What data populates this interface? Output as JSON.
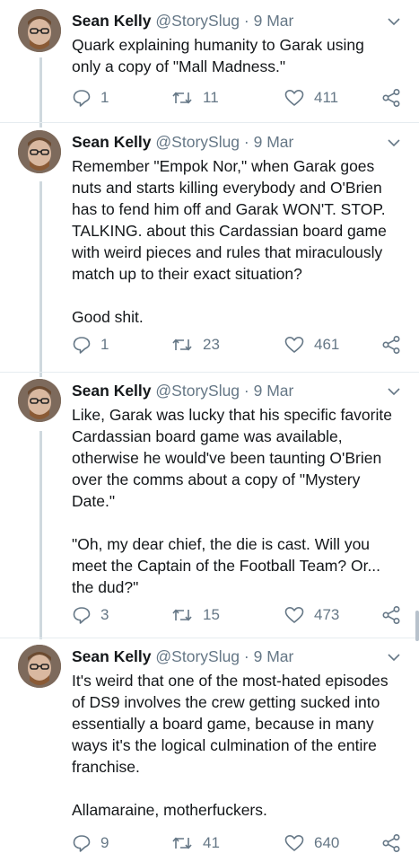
{
  "colors": {
    "text": "#14171a",
    "meta": "#657786",
    "thread_line": "#cfd9de",
    "divider": "#e6ecf0",
    "icon": "#657786"
  },
  "tweets": [
    {
      "author_name": "Sean Kelly",
      "handle": "@StorySlug",
      "dot": "·",
      "date": "9 Mar",
      "text": "Quark explaining humanity to Garak using only a copy of \"Mall Madness.\"",
      "replies": "1",
      "retweets": "11",
      "likes": "411"
    },
    {
      "author_name": "Sean Kelly",
      "handle": "@StorySlug",
      "dot": "·",
      "date": "9 Mar",
      "text": "Remember \"Empok Nor,\" when Garak goes nuts and starts killing everybody and O'Brien has to fend him off and Garak WON'T. STOP. TALKING. about this Cardassian board game with weird pieces and rules that miraculously match up to their exact situation?\n\nGood shit.",
      "replies": "1",
      "retweets": "23",
      "likes": "461"
    },
    {
      "author_name": "Sean Kelly",
      "handle": "@StorySlug",
      "dot": "·",
      "date": "9 Mar",
      "text": "Like, Garak was lucky that his specific favorite Cardassian board game was available, otherwise he would've been taunting O'Brien over the comms about a copy of \"Mystery Date.\"\n\n\"Oh, my dear chief, the die is cast. Will you meet the Captain of the Football Team? Or... the dud?\"",
      "replies": "3",
      "retweets": "15",
      "likes": "473"
    },
    {
      "author_name": "Sean Kelly",
      "handle": "@StorySlug",
      "dot": "·",
      "date": "9 Mar",
      "text": "It's weird that one of the most-hated episodes of DS9 involves the crew getting sucked into essentially a board game, because in many ways it's the logical culmination of the entire franchise.\n\nAllamaraine, motherfuckers.",
      "replies": "9",
      "retweets": "41",
      "likes": "640"
    }
  ],
  "icons": {
    "avatar": "avatar-photo",
    "caret": "chevron-down-icon",
    "reply": "reply-icon",
    "retweet": "retweet-icon",
    "like": "heart-icon",
    "share": "share-icon"
  }
}
